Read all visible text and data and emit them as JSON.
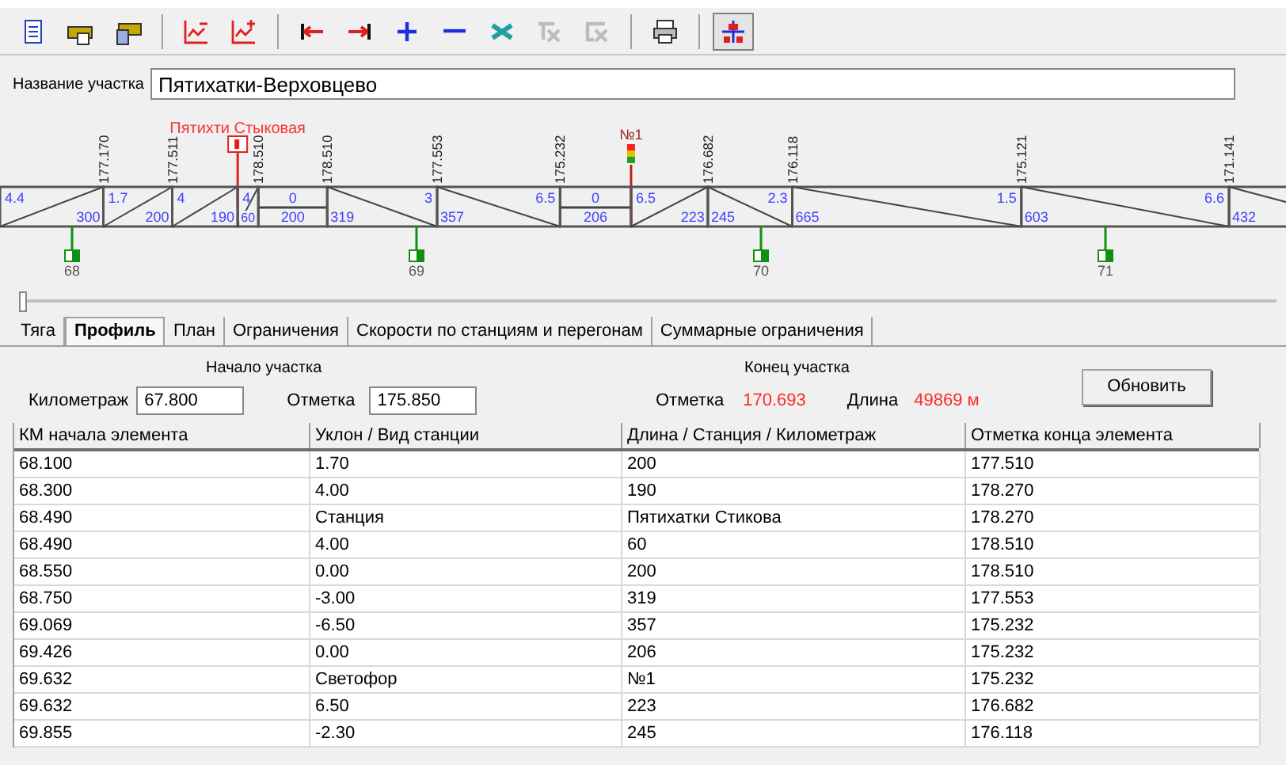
{
  "toolbar": {
    "groups": [
      [
        {
          "disabled": false,
          "pressed": false
        },
        {
          "disabled": false,
          "pressed": false
        },
        {
          "disabled": false,
          "pressed": false
        }
      ],
      [
        {
          "disabled": false,
          "pressed": false
        },
        {
          "disabled": false,
          "pressed": false
        }
      ],
      [
        {
          "disabled": false,
          "pressed": false
        },
        {
          "disabled": false,
          "pressed": false
        },
        {
          "disabled": false,
          "pressed": false
        },
        {
          "disabled": false,
          "pressed": false
        },
        {
          "disabled": false,
          "pressed": false
        },
        {
          "disabled": true,
          "pressed": false
        },
        {
          "disabled": true,
          "pressed": false
        }
      ],
      [
        {
          "disabled": false,
          "pressed": false
        }
      ],
      [
        {
          "disabled": false,
          "pressed": true
        }
      ]
    ]
  },
  "section_name": {
    "label": "Название участка",
    "value": "Пятихатки-Верховцево"
  },
  "profile": {
    "segments": [
      {
        "kind": "up",
        "slope": "4.4",
        "length": "300",
        "end_mark": "177.170"
      },
      {
        "kind": "up",
        "slope": "1.7",
        "length": "200",
        "end_mark": "177.511"
      },
      {
        "kind": "up",
        "slope": "4",
        "length": "190",
        "marker": {
          "kind": "station",
          "label": "Пятихти Стыковая"
        }
      },
      {
        "kind": "up",
        "slope": "4",
        "length": "60",
        "end_mark": "178.510"
      },
      {
        "kind": "flat",
        "slope": "0",
        "length": "200",
        "end_mark": "178.510"
      },
      {
        "kind": "down",
        "slope": "3",
        "length": "319",
        "end_mark": "177.553"
      },
      {
        "kind": "down",
        "slope": "6.5",
        "length": "357",
        "end_mark": "175.232"
      },
      {
        "kind": "flat",
        "slope": "0",
        "length": "206",
        "marker": {
          "kind": "signal",
          "label": "№1"
        }
      },
      {
        "kind": "up",
        "slope": "6.5",
        "length": "223",
        "end_mark": "176.682"
      },
      {
        "kind": "down",
        "slope": "2.3",
        "length": "245",
        "end_mark": "176.118"
      },
      {
        "kind": "down",
        "slope": "1.5",
        "length": "665",
        "end_mark": "175.121"
      },
      {
        "kind": "down",
        "slope": "6.6",
        "length": "603",
        "end_mark": "171.141"
      },
      {
        "kind": "down",
        "length": "432"
      }
    ],
    "km_posts": [
      "68",
      "69",
      "70",
      "71"
    ]
  },
  "tabs": [
    {
      "label": "Тяга",
      "selected": false
    },
    {
      "label": "Профиль",
      "selected": true
    },
    {
      "label": "План",
      "selected": false
    },
    {
      "label": "Ограничения",
      "selected": false
    },
    {
      "label": "Скорости по станциям и перегонам",
      "selected": false
    },
    {
      "label": "Суммарные ограничения",
      "selected": false
    }
  ],
  "start": {
    "title": "Начало участка",
    "km_label": "Километраж",
    "km_value": "67.800",
    "mark_label": "Отметка",
    "mark_value": "175.850"
  },
  "end": {
    "title": "Конец участка",
    "mark_label": "Отметка",
    "mark_value": "170.693",
    "length_label": "Длина",
    "length_value": "49869 м"
  },
  "refresh_button": "Обновить",
  "table": {
    "columns": [
      "КМ начала элемента",
      "Уклон / Вид станции",
      "Длина / Станция / Километраж",
      "Отметка конца элемента"
    ],
    "rows": [
      [
        "68.100",
        "1.70",
        "200",
        "177.510"
      ],
      [
        "68.300",
        "4.00",
        "190",
        "178.270"
      ],
      [
        "68.490",
        "Станция",
        "Пятихатки Стикова",
        "178.270"
      ],
      [
        "68.490",
        "4.00",
        "60",
        "178.510"
      ],
      [
        "68.550",
        "0.00",
        "200",
        "178.510"
      ],
      [
        "68.750",
        "-3.00",
        "319",
        "177.553"
      ],
      [
        "69.069",
        "-6.50",
        "357",
        "175.232"
      ],
      [
        "69.426",
        "0.00",
        "206",
        "175.232"
      ],
      [
        "69.632",
        "Светофор",
        "№1",
        "175.232"
      ],
      [
        "69.632",
        "6.50",
        "223",
        "176.682"
      ],
      [
        "69.855",
        "-2.30",
        "245",
        "176.118"
      ]
    ]
  }
}
